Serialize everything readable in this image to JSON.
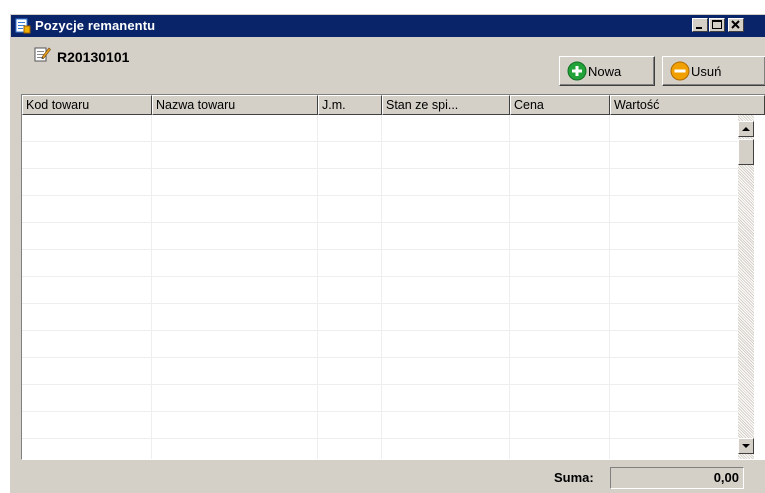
{
  "window": {
    "title": "Pozycje remanentu",
    "colors": {
      "titlebar": "#0a246a",
      "face": "#d4d0c8",
      "title_text": "#ffffff"
    }
  },
  "document": {
    "number": "R20130101"
  },
  "toolbar": {
    "new_label": "Nowa",
    "new_icon": "plus-circle-icon",
    "new_icon_color": "#22a33a",
    "delete_label": "Usuń",
    "delete_icon": "minus-circle-icon",
    "delete_icon_color": "#f0a000"
  },
  "grid": {
    "columns": [
      "Kod towaru",
      "Nazwa towaru",
      "J.m.",
      "Stan ze spi...",
      "Cena",
      "Wartość"
    ],
    "rows": []
  },
  "footer": {
    "sum_label": "Suma:",
    "sum_value": "0,00"
  }
}
